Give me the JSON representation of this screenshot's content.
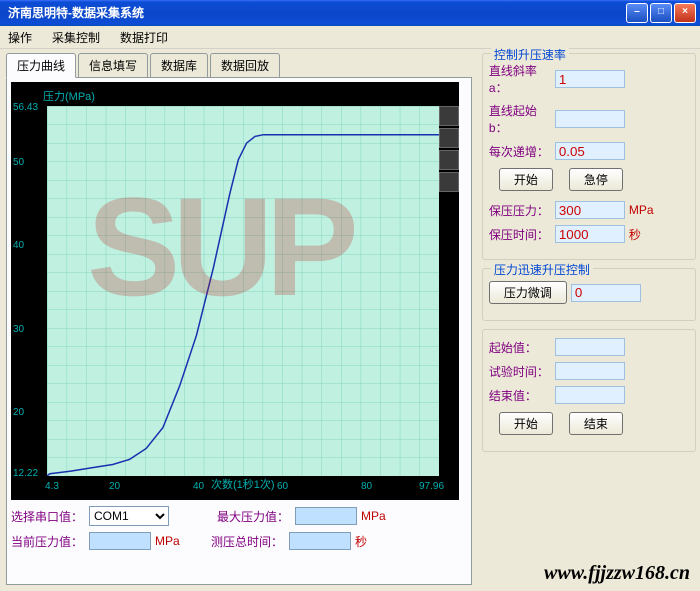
{
  "window": {
    "title": "济南思明特-数据采集系统"
  },
  "menu": {
    "items": [
      "操作",
      "采集控制",
      "数据打印"
    ]
  },
  "tabs": [
    "压力曲线",
    "信息填写",
    "数据库",
    "数据回放"
  ],
  "chart_data": {
    "type": "line",
    "title": "",
    "xlabel": "次数(1秒1次)",
    "ylabel": "压力(MPa)",
    "xlim": [
      4.3,
      97.96
    ],
    "ylim": [
      12.22,
      56.43
    ],
    "yticks": [
      12.22,
      20,
      30,
      40,
      50,
      56.43
    ],
    "xticks": [
      4.3,
      20,
      40,
      60,
      80,
      97.96
    ],
    "series": [
      {
        "name": "pressure",
        "x": [
          4.3,
          5,
          10,
          15,
          20,
          24,
          28,
          32,
          36,
          40,
          44,
          48,
          50,
          52,
          54,
          56,
          60,
          70,
          80,
          90,
          97.96
        ],
        "y": [
          12.22,
          12.5,
          12.8,
          13.2,
          13.6,
          14.2,
          15.5,
          18,
          23,
          29,
          37,
          46,
          50,
          52,
          52.8,
          53,
          53,
          53,
          53,
          53,
          53
        ]
      }
    ]
  },
  "chart_watermark": "SUP",
  "bottom": {
    "serial_label": "选择串口值：",
    "serial_value": "COM1",
    "current_label": "当前压力值：",
    "current_value": "",
    "current_unit": "MPa",
    "max_label": "最大压力值：",
    "max_value": "",
    "max_unit": "MPa",
    "total_time_label": "测压总时间：",
    "total_time_value": "",
    "total_time_unit": "秒"
  },
  "control_rate": {
    "title": "控制升压速率",
    "slope_label": "直线斜率a：",
    "slope_value": "1",
    "start_label": "直线起始b：",
    "start_value": "",
    "step_label": "每次递增：",
    "step_value": "0.05",
    "start_btn": "开始",
    "pause_btn": "急停",
    "hold_pressure_label": "保压压力：",
    "hold_pressure_value": "300",
    "hold_pressure_unit": "MPa",
    "hold_time_label": "保压时间：",
    "hold_time_value": "1000",
    "hold_time_unit": "秒"
  },
  "fast_control": {
    "title": "压力迅速升压控制",
    "fine_btn": "压力微调",
    "fine_value": "0"
  },
  "test": {
    "start_label": "起始值：",
    "start_value": "",
    "time_label": "试验时间：",
    "time_value": "",
    "end_label": "结束值：",
    "end_value": "",
    "start_btn": "开始",
    "end_btn": "结束"
  },
  "watermark_url": "www.fjjzzw168.cn"
}
